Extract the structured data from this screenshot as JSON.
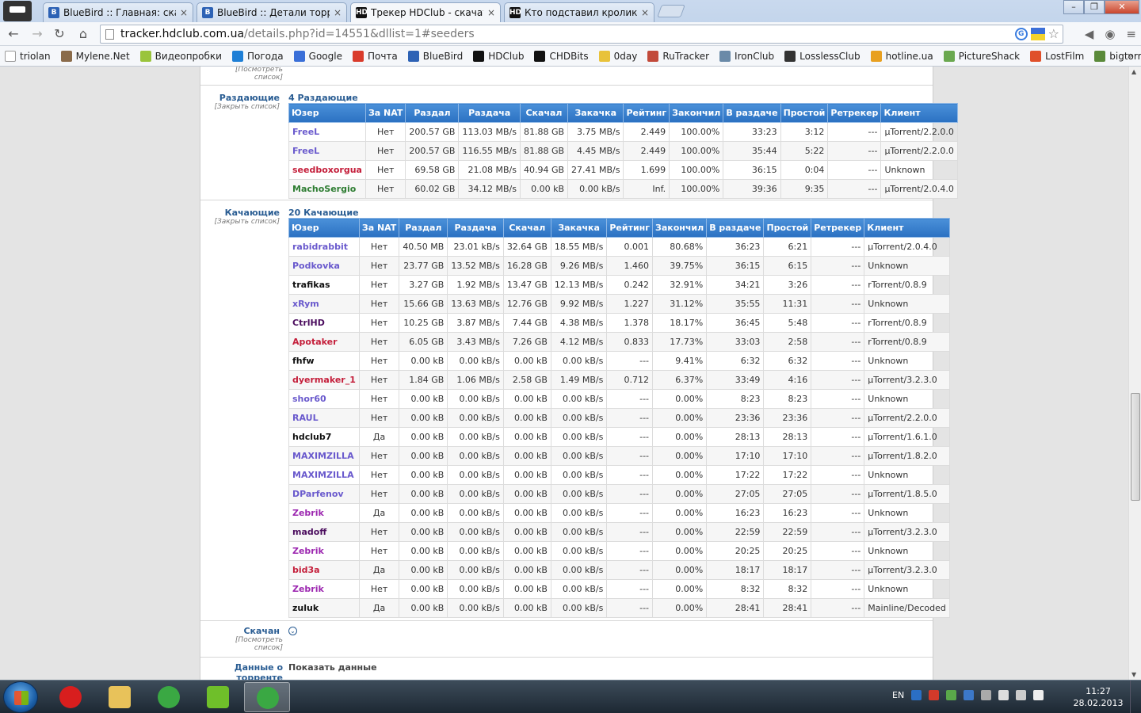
{
  "browser": {
    "tabs": [
      {
        "title": "BlueBird :: Главная: скача",
        "icon": "bluebird-icon",
        "active": false
      },
      {
        "title": "BlueBird :: Детали торрен",
        "icon": "bluebird-icon",
        "active": false
      },
      {
        "title": "Трекер HDClub - скачать",
        "icon": "hdclub-icon",
        "active": true
      },
      {
        "title": "Кто подставил кролика Р",
        "icon": "hdclub-icon",
        "active": false
      }
    ],
    "url_host": "tracker.hdclub.com.ua",
    "url_path": "/details.php?id=14551&dllist=1#seeders",
    "bookmarks": [
      {
        "label": "triolan",
        "color": "#ffffff"
      },
      {
        "label": "Mylene.Net",
        "color": "#8a6b4a"
      },
      {
        "label": "Видеопробки",
        "color": "#9ac43c"
      },
      {
        "label": "Погода",
        "color": "#1e7fd6"
      },
      {
        "label": "Google",
        "color": "#3a6fd8"
      },
      {
        "label": "Почта",
        "color": "#d93b2b"
      },
      {
        "label": "BlueBird",
        "color": "#2d62b5"
      },
      {
        "label": "HDClub",
        "color": "#111111"
      },
      {
        "label": "CHDBits",
        "color": "#111111"
      },
      {
        "label": "0day",
        "color": "#e8c23a"
      },
      {
        "label": "RuTracker",
        "color": "#c24a3a"
      },
      {
        "label": "IronClub",
        "color": "#6a8aa8"
      },
      {
        "label": "LosslessClub",
        "color": "#333333"
      },
      {
        "label": "hotline.ua",
        "color": "#e8a020"
      },
      {
        "label": "PictureShack",
        "color": "#6aa84f"
      },
      {
        "label": "LostFilm",
        "color": "#e0502a"
      },
      {
        "label": "bigtorrent.org",
        "color": "#5a8a3a"
      }
    ],
    "bookmarks_more": "»"
  },
  "top_section": {
    "sub": "[Посмотреть список]"
  },
  "seeders": {
    "title": "Раздающие",
    "sub": "[Закрыть список]",
    "count": "4 Раздающие",
    "headers": [
      "Юзер",
      "За NAT",
      "Раздал",
      "Раздача",
      "Скачал",
      "Закачка",
      "Рейтинг",
      "Закончил",
      "В раздаче",
      "Простой",
      "Ретрекер",
      "Клиент"
    ],
    "rows": [
      {
        "user": "FreeL",
        "color": "#6a5acd",
        "nat": "Нет",
        "up": "200.57 GB",
        "up_speed": "113.03 MB/s",
        "down": "81.88 GB",
        "down_speed": "3.75 MB/s",
        "ratio": "2.449",
        "ratio_low": false,
        "done": "100.00%",
        "seeding": "33:23",
        "idle": "3:12",
        "retracker": "---",
        "client": "µTorrent/2.2.0.0"
      },
      {
        "user": "FreeL",
        "color": "#6a5acd",
        "nat": "Нет",
        "up": "200.57 GB",
        "up_speed": "116.55 MB/s",
        "down": "81.88 GB",
        "down_speed": "4.45 MB/s",
        "ratio": "2.449",
        "ratio_low": false,
        "done": "100.00%",
        "seeding": "35:44",
        "idle": "5:22",
        "retracker": "---",
        "client": "µTorrent/2.2.0.0"
      },
      {
        "user": "seedboxorgua",
        "color": "#c41e3a",
        "nat": "Нет",
        "up": "69.58 GB",
        "up_speed": "21.08 MB/s",
        "down": "40.94 GB",
        "down_speed": "27.41 MB/s",
        "ratio": "1.699",
        "ratio_low": false,
        "done": "100.00%",
        "seeding": "36:15",
        "idle": "0:04",
        "retracker": "---",
        "client": "Unknown"
      },
      {
        "user": "MachoSergio",
        "color": "#2e7d32",
        "nat": "Нет",
        "up": "60.02 GB",
        "up_speed": "34.12 MB/s",
        "down": "0.00 kB",
        "down_speed": "0.00 kB/s",
        "ratio": "Inf.",
        "ratio_low": false,
        "done": "100.00%",
        "seeding": "39:36",
        "idle": "9:35",
        "retracker": "---",
        "client": "µTorrent/2.0.4.0"
      }
    ]
  },
  "leechers": {
    "title": "Качающие",
    "sub": "[Закрыть список]",
    "count": "20 Качающие",
    "headers": [
      "Юзер",
      "За NAT",
      "Раздал",
      "Раздача",
      "Скачал",
      "Закачка",
      "Рейтинг",
      "Закончил",
      "В раздаче",
      "Простой",
      "Ретрекер",
      "Клиент"
    ],
    "rows": [
      {
        "user": "rabidrabbit",
        "color": "#6a5acd",
        "nat": "Нет",
        "up": "40.50 MB",
        "up_speed": "23.01 kB/s",
        "down": "32.64 GB",
        "down_speed": "18.55 MB/s",
        "ratio": "0.001",
        "ratio_low": true,
        "done": "80.68%",
        "seeding": "36:23",
        "idle": "6:21",
        "retracker": "---",
        "client": "µTorrent/2.0.4.0"
      },
      {
        "user": "Podkovka",
        "color": "#6a5acd",
        "nat": "Нет",
        "up": "23.77 GB",
        "up_speed": "13.52 MB/s",
        "down": "16.28 GB",
        "down_speed": "9.26 MB/s",
        "ratio": "1.460",
        "ratio_low": false,
        "done": "39.75%",
        "seeding": "36:15",
        "idle": "6:15",
        "retracker": "---",
        "client": "Unknown"
      },
      {
        "user": "trafikas",
        "color": "#111111",
        "nat": "Нет",
        "up": "3.27 GB",
        "up_speed": "1.92 MB/s",
        "down": "13.47 GB",
        "down_speed": "12.13 MB/s",
        "ratio": "0.242",
        "ratio_low": true,
        "done": "32.91%",
        "seeding": "34:21",
        "idle": "3:26",
        "retracker": "---",
        "client": "rTorrent/0.8.9"
      },
      {
        "user": "xRym",
        "color": "#6a5acd",
        "nat": "Нет",
        "up": "15.66 GB",
        "up_speed": "13.63 MB/s",
        "down": "12.76 GB",
        "down_speed": "9.92 MB/s",
        "ratio": "1.227",
        "ratio_low": false,
        "done": "31.12%",
        "seeding": "35:55",
        "idle": "11:31",
        "retracker": "---",
        "client": "Unknown"
      },
      {
        "user": "CtrlHD",
        "color": "#4b0d5e",
        "nat": "Нет",
        "up": "10.25 GB",
        "up_speed": "3.87 MB/s",
        "down": "7.44 GB",
        "down_speed": "4.38 MB/s",
        "ratio": "1.378",
        "ratio_low": false,
        "done": "18.17%",
        "seeding": "36:45",
        "idle": "5:48",
        "retracker": "---",
        "client": "rTorrent/0.8.9"
      },
      {
        "user": "Apotaker",
        "color": "#c41e3a",
        "nat": "Нет",
        "up": "6.05 GB",
        "up_speed": "3.43 MB/s",
        "down": "7.26 GB",
        "down_speed": "4.12 MB/s",
        "ratio": "0.833",
        "ratio_low": true,
        "done": "17.73%",
        "seeding": "33:03",
        "idle": "2:58",
        "retracker": "---",
        "client": "rTorrent/0.8.9"
      },
      {
        "user": "fhfw",
        "color": "#111111",
        "nat": "Нет",
        "up": "0.00 kB",
        "up_speed": "0.00 kB/s",
        "down": "0.00 kB",
        "down_speed": "0.00 kB/s",
        "ratio": "---",
        "ratio_low": false,
        "done": "9.41%",
        "seeding": "6:32",
        "idle": "6:32",
        "retracker": "---",
        "client": "Unknown"
      },
      {
        "user": "dyermaker_1",
        "color": "#c41e3a",
        "nat": "Нет",
        "up": "1.84 GB",
        "up_speed": "1.06 MB/s",
        "down": "2.58 GB",
        "down_speed": "1.49 MB/s",
        "ratio": "0.712",
        "ratio_low": true,
        "done": "6.37%",
        "seeding": "33:49",
        "idle": "4:16",
        "retracker": "---",
        "client": "µTorrent/3.2.3.0"
      },
      {
        "user": "shor60",
        "color": "#6a5acd",
        "nat": "Нет",
        "up": "0.00 kB",
        "up_speed": "0.00 kB/s",
        "down": "0.00 kB",
        "down_speed": "0.00 kB/s",
        "ratio": "---",
        "ratio_low": false,
        "done": "0.00%",
        "seeding": "8:23",
        "idle": "8:23",
        "retracker": "---",
        "client": "Unknown"
      },
      {
        "user": "RAUL",
        "color": "#6a5acd",
        "nat": "Нет",
        "up": "0.00 kB",
        "up_speed": "0.00 kB/s",
        "down": "0.00 kB",
        "down_speed": "0.00 kB/s",
        "ratio": "---",
        "ratio_low": false,
        "done": "0.00%",
        "seeding": "23:36",
        "idle": "23:36",
        "retracker": "---",
        "client": "µTorrent/2.2.0.0"
      },
      {
        "user": "hdclub7",
        "color": "#111111",
        "nat": "Да",
        "up": "0.00 kB",
        "up_speed": "0.00 kB/s",
        "down": "0.00 kB",
        "down_speed": "0.00 kB/s",
        "ratio": "---",
        "ratio_low": false,
        "done": "0.00%",
        "seeding": "28:13",
        "idle": "28:13",
        "retracker": "---",
        "client": "µTorrent/1.6.1.0"
      },
      {
        "user": "MAXIMZILLA",
        "color": "#6a5acd",
        "nat": "Нет",
        "up": "0.00 kB",
        "up_speed": "0.00 kB/s",
        "down": "0.00 kB",
        "down_speed": "0.00 kB/s",
        "ratio": "---",
        "ratio_low": false,
        "done": "0.00%",
        "seeding": "17:10",
        "idle": "17:10",
        "retracker": "---",
        "client": "µTorrent/1.8.2.0"
      },
      {
        "user": "MAXIMZILLA",
        "color": "#6a5acd",
        "nat": "Нет",
        "up": "0.00 kB",
        "up_speed": "0.00 kB/s",
        "down": "0.00 kB",
        "down_speed": "0.00 kB/s",
        "ratio": "---",
        "ratio_low": false,
        "done": "0.00%",
        "seeding": "17:22",
        "idle": "17:22",
        "retracker": "---",
        "client": "Unknown"
      },
      {
        "user": "DParfenov",
        "color": "#6a5acd",
        "nat": "Нет",
        "up": "0.00 kB",
        "up_speed": "0.00 kB/s",
        "down": "0.00 kB",
        "down_speed": "0.00 kB/s",
        "ratio": "---",
        "ratio_low": false,
        "done": "0.00%",
        "seeding": "27:05",
        "idle": "27:05",
        "retracker": "---",
        "client": "µTorrent/1.8.5.0"
      },
      {
        "user": "Zebrik",
        "color": "#9c27b0",
        "nat": "Да",
        "up": "0.00 kB",
        "up_speed": "0.00 kB/s",
        "down": "0.00 kB",
        "down_speed": "0.00 kB/s",
        "ratio": "---",
        "ratio_low": false,
        "done": "0.00%",
        "seeding": "16:23",
        "idle": "16:23",
        "retracker": "---",
        "client": "Unknown"
      },
      {
        "user": "madoff",
        "color": "#4b0d5e",
        "nat": "Нет",
        "up": "0.00 kB",
        "up_speed": "0.00 kB/s",
        "down": "0.00 kB",
        "down_speed": "0.00 kB/s",
        "ratio": "---",
        "ratio_low": false,
        "done": "0.00%",
        "seeding": "22:59",
        "idle": "22:59",
        "retracker": "---",
        "client": "µTorrent/3.2.3.0"
      },
      {
        "user": "Zebrik",
        "color": "#9c27b0",
        "nat": "Нет",
        "up": "0.00 kB",
        "up_speed": "0.00 kB/s",
        "down": "0.00 kB",
        "down_speed": "0.00 kB/s",
        "ratio": "---",
        "ratio_low": false,
        "done": "0.00%",
        "seeding": "20:25",
        "idle": "20:25",
        "retracker": "---",
        "client": "Unknown"
      },
      {
        "user": "bid3a",
        "color": "#c41e3a",
        "nat": "Да",
        "up": "0.00 kB",
        "up_speed": "0.00 kB/s",
        "down": "0.00 kB",
        "down_speed": "0.00 kB/s",
        "ratio": "---",
        "ratio_low": false,
        "done": "0.00%",
        "seeding": "18:17",
        "idle": "18:17",
        "retracker": "---",
        "client": "µTorrent/3.2.3.0"
      },
      {
        "user": "Zebrik",
        "color": "#9c27b0",
        "nat": "Нет",
        "up": "0.00 kB",
        "up_speed": "0.00 kB/s",
        "down": "0.00 kB",
        "down_speed": "0.00 kB/s",
        "ratio": "---",
        "ratio_low": false,
        "done": "0.00%",
        "seeding": "8:32",
        "idle": "8:32",
        "retracker": "---",
        "client": "Unknown"
      },
      {
        "user": "zuluk",
        "color": "#111111",
        "nat": "Да",
        "up": "0.00 kB",
        "up_speed": "0.00 kB/s",
        "down": "0.00 kB",
        "down_speed": "0.00 kB/s",
        "ratio": "---",
        "ratio_low": false,
        "done": "0.00%",
        "seeding": "28:41",
        "idle": "28:41",
        "retracker": "---",
        "client": "Mainline/Decoded"
      }
    ]
  },
  "downloaded": {
    "title": "Скачан",
    "sub": "[Посмотреть список]",
    "icon": "expand-icon"
  },
  "torrent_data": {
    "title": "Данные о торренте",
    "value": "Показать данные"
  },
  "taskbar": {
    "apps": [
      {
        "name": "opera",
        "color": "#d81e1e",
        "active": false
      },
      {
        "name": "explorer",
        "color": "#e8c25a",
        "active": false
      },
      {
        "name": "chrome",
        "color": "#3aa843",
        "active": false
      },
      {
        "name": "utorrent",
        "color": "#6fbf2a",
        "active": false
      },
      {
        "name": "chrome",
        "color": "#3aa843",
        "active": true
      }
    ],
    "lang": "EN",
    "time": "11:27",
    "date": "28.02.2013"
  }
}
